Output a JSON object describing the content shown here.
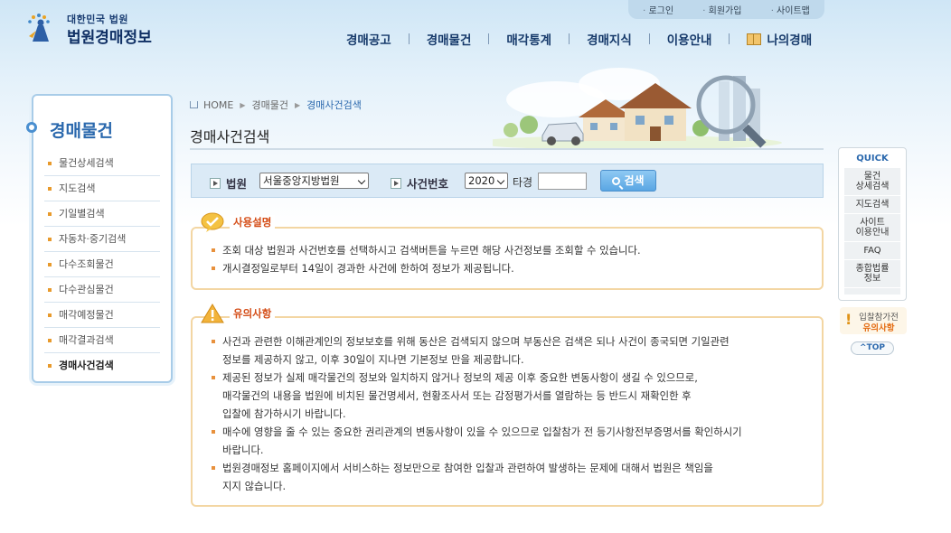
{
  "header": {
    "logo_small": "대한민국 법원",
    "logo_big": "법원경매정보",
    "util_links": [
      "로그인",
      "회원가입",
      "사이트맵"
    ],
    "gnb": [
      "경매공고",
      "경매물건",
      "매각통계",
      "경매지식",
      "이용안내",
      "나의경매"
    ]
  },
  "lnb": {
    "title": "경매물건",
    "items": [
      "물건상세검색",
      "지도검색",
      "기일별검색",
      "자동차·중기검색",
      "다수조회물건",
      "다수관심물건",
      "매각예정물건",
      "매각결과검색",
      "경매사건검색"
    ],
    "active_index": 8
  },
  "breadcrumb": [
    "HOME",
    "경매물건",
    "경매사건검색"
  ],
  "page_title": "경매사건검색",
  "search": {
    "court_label": "법원",
    "court_value": "서울중앙지방법원",
    "case_label": "사건번호",
    "year_value": "2020",
    "case_type": "타경",
    "case_input_value": "",
    "button_label": "검색"
  },
  "usage": {
    "title": "사용설명",
    "items": [
      "조회 대상 법원과 사건번호를 선택하시고 검색버튼을 누르면 해당 사건정보를 조회할 수 있습니다.",
      "개시결정일로부터 14일이 경과한 사건에 한하여 정보가 제공됩니다."
    ]
  },
  "caution": {
    "title": "유의사항",
    "items": [
      [
        "사건과 관련한 이해관계인의 정보보호를 위해 동산은 검색되지 않으며 부동산은 검색은 되나 사건이 종국되면 기일관련",
        "정보를 제공하지 않고, 이후 30일이 지나면 기본정보 만을 제공합니다."
      ],
      [
        "제공된 정보가 실제 매각물건의 정보와 일치하지 않거나 정보의 제공 이후 중요한 변동사항이 생길 수 있으므로,",
        "매각물건의 내용을 법원에 비치된 물건명세서, 현황조사서 또는 감정평가서를 열람하는 등 반드시 재확인한 후",
        "입찰에 참가하시기 바랍니다."
      ],
      [
        "매수에 영향을 줄 수 있는 중요한 권리관계의 변동사항이 있을 수 있으므로 입찰참가 전 등기사항전부증명서를 확인하시기",
        "바랍니다."
      ],
      [
        "법원경매정보 홈페이지에서 서비스하는 정보만으로 참여한 입찰과 관련하여 발생하는 문제에 대해서 법원은 책임을",
        "지지 않습니다."
      ]
    ]
  },
  "quick": {
    "title": "QUICK",
    "items": [
      [
        "물건",
        "상세검색"
      ],
      [
        "지도검색"
      ],
      [
        "사이트",
        "이용안내"
      ],
      [
        "FAQ"
      ],
      [
        "종합법률",
        "정보"
      ]
    ],
    "notice_line1": "입찰참가전",
    "notice_line2": "유의사항",
    "top_label": "TOP"
  }
}
